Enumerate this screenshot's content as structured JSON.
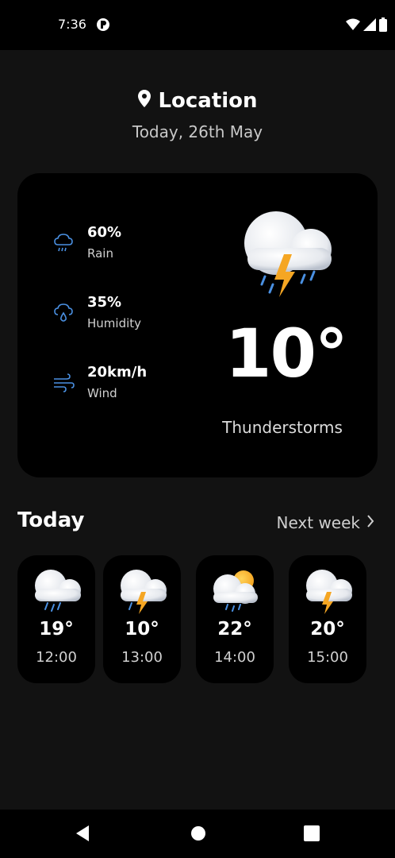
{
  "status": {
    "time": "7:36",
    "app_icon": "privacy-indicator-icon",
    "icons": [
      "wifi-icon",
      "signal-icon",
      "battery-icon"
    ]
  },
  "header": {
    "location": "Location",
    "date": "Today, 26th May"
  },
  "current": {
    "stats": [
      {
        "value": "60%",
        "label": "Rain",
        "icon": "rain-cloud-icon"
      },
      {
        "value": "35%",
        "label": "Humidity",
        "icon": "humidity-icon"
      },
      {
        "value": "20km/h",
        "label": "Wind",
        "icon": "wind-icon"
      }
    ],
    "temperature": "10°",
    "condition": "Thunderstorms",
    "icon": "thunderstorm-icon"
  },
  "today": {
    "title": "Today",
    "next_week": "Next week",
    "hours": [
      {
        "temp": "19°",
        "time": "12:00",
        "icon": "rain-icon"
      },
      {
        "temp": "10°",
        "time": "13:00",
        "icon": "thunderstorm-icon"
      },
      {
        "temp": "22°",
        "time": "14:00",
        "icon": "sun-rain-icon"
      },
      {
        "temp": "20°",
        "time": "15:00",
        "icon": "thunderstorm-icon"
      }
    ]
  },
  "colors": {
    "background": "#121212",
    "card": "#000000",
    "accent": "#4a90e2",
    "bolt": "#f5a623"
  }
}
